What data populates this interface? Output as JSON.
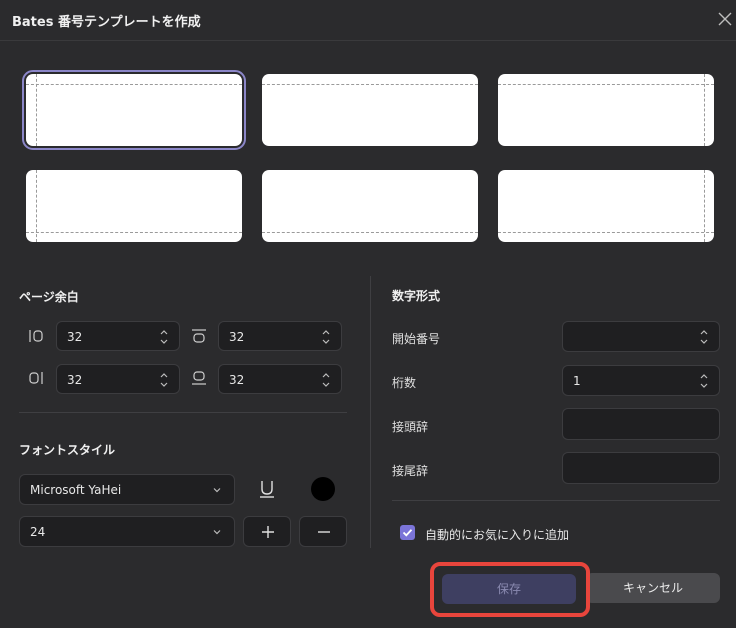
{
  "dialog": {
    "title": "Bates 番号テンプレートを作成"
  },
  "margins": {
    "heading": "ページ余白",
    "left": "32",
    "top": "32",
    "right": "32",
    "bottom": "32"
  },
  "font": {
    "heading": "フォントスタイル",
    "family": "Microsoft YaHei",
    "size": "24",
    "color": "#000000"
  },
  "number_format": {
    "heading": "数字形式",
    "start_label": "開始番号",
    "start_value": "",
    "digits_label": "桁数",
    "digits_value": "1",
    "prefix_label": "接頭辞",
    "prefix_value": "",
    "suffix_label": "接尾辞",
    "suffix_value": ""
  },
  "favorite": {
    "label": "自動的にお気に入りに追加",
    "checked": true
  },
  "buttons": {
    "save": "保存",
    "cancel": "キャンセル"
  },
  "colors": {
    "accent": "#7b74d8",
    "highlight": "#e8453c"
  }
}
